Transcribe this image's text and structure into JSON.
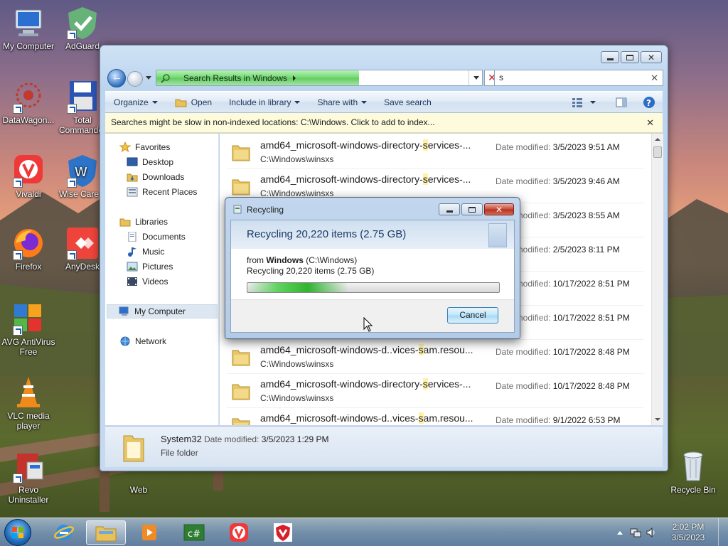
{
  "desktop": {
    "icons": [
      {
        "label": "My Computer"
      },
      {
        "label": "AdGuard"
      },
      {
        "label": "DataWagon..."
      },
      {
        "label": "Total Commander"
      },
      {
        "label": "Vivaldi"
      },
      {
        "label": "Wise Care 3"
      },
      {
        "label": "Firefox"
      },
      {
        "label": "AnyDesk"
      },
      {
        "label": "AVG AntiVirus Free"
      },
      {
        "label": "VLC media player"
      },
      {
        "label": "Revo Uninstaller"
      },
      {
        "label": "Web"
      },
      {
        "label": "Recycle Bin"
      }
    ]
  },
  "explorer": {
    "address": "Search Results in Windows",
    "search_value": "s",
    "toolbar": {
      "organize": "Organize",
      "open": "Open",
      "include": "Include in library",
      "share": "Share with",
      "save_search": "Save search"
    },
    "infobar": "Searches might be slow in non-indexed locations: C:\\Windows. Click to add to index...",
    "nav": {
      "favorites": "Favorites",
      "desktop": "Desktop",
      "downloads": "Downloads",
      "recent": "Recent Places",
      "libraries": "Libraries",
      "documents": "Documents",
      "music": "Music",
      "pictures": "Pictures",
      "videos": "Videos",
      "computer": "My Computer",
      "network": "Network"
    },
    "date_label": "Date modified:",
    "results": [
      {
        "pre": "amd64_microsoft-windows-directory-",
        "hl": "s",
        "post": "ervices-...",
        "path": "C:\\Windows\\winsxs",
        "date": "3/5/2023 9:51 AM"
      },
      {
        "pre": "amd64_microsoft-windows-directory-",
        "hl": "s",
        "post": "ervices-...",
        "path": "C:\\Windows\\winsxs",
        "date": "3/5/2023 9:46 AM"
      },
      {
        "pre": "",
        "hl": "",
        "post": "",
        "path": "",
        "date": "3/5/2023 8:55 AM"
      },
      {
        "pre": "",
        "hl": "",
        "post": "",
        "path": "",
        "date": "2/5/2023 8:11 PM"
      },
      {
        "pre": "",
        "hl": "",
        "post": "",
        "path": "",
        "date": "10/17/2022 8:51 PM"
      },
      {
        "pre": "",
        "hl": "",
        "post": "",
        "path": "",
        "date": "10/17/2022 8:51 PM"
      },
      {
        "pre": "amd64_microsoft-windows-d..vices-",
        "hl": "s",
        "post": "am.resou...",
        "path": "C:\\Windows\\winsxs",
        "date": "10/17/2022 8:48 PM"
      },
      {
        "pre": "amd64_microsoft-windows-directory-",
        "hl": "s",
        "post": "ervices-...",
        "path": "C:\\Windows\\winsxs",
        "date": "10/17/2022 8:48 PM"
      },
      {
        "pre": "amd64_microsoft-windows-d..vices-",
        "hl": "s",
        "post": "am.resou...",
        "path": "C:\\Windows\\winsxs",
        "date": "9/1/2022 6:53 PM"
      }
    ],
    "details": {
      "name": "System32",
      "date_label": "Date modified:",
      "date": "3/5/2023 1:29 PM",
      "type": "File folder"
    }
  },
  "dialog": {
    "title": "Recycling",
    "header": "Recycling 20,220 items (2.75 GB)",
    "from_prefix": "from",
    "from_name": "Windows",
    "from_path": "(C:\\Windows)",
    "status": "Recycling 20,220 items (2.75 GB)",
    "progress_visible_fraction": 0.4,
    "cancel": "Cancel"
  },
  "taskbar": {
    "time": "2:02 PM",
    "date": "3/5/2023"
  },
  "colors": {
    "accent": "#1c5fb5",
    "highlight": "#fff2a6",
    "progress": "#2fb52f"
  }
}
